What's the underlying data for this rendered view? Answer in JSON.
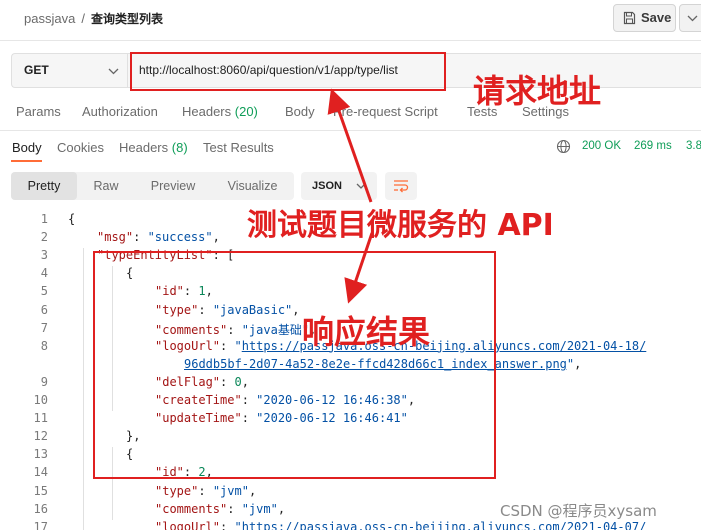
{
  "breadcrumb": {
    "collection": "passjava",
    "separator": "/",
    "request": "查询类型列表"
  },
  "toolbar": {
    "save_label": "Save"
  },
  "request": {
    "method": "GET",
    "url": "http://localhost:8060/api/question/v1/app/type/list"
  },
  "request_tabs": [
    {
      "label": "Params"
    },
    {
      "label": "Authorization"
    },
    {
      "label": "Headers",
      "count": "(20)"
    },
    {
      "label": "Body"
    },
    {
      "label": "Pre-request Script"
    },
    {
      "label": "Tests"
    },
    {
      "label": "Settings"
    }
  ],
  "response_tabs": [
    {
      "label": "Body",
      "active": true
    },
    {
      "label": "Cookies"
    },
    {
      "label": "Headers",
      "count": "(8)"
    },
    {
      "label": "Test Results"
    }
  ],
  "response_status": {
    "code": "200 OK",
    "time": "269 ms",
    "size": "3.8"
  },
  "view_modes": [
    "Pretty",
    "Raw",
    "Preview",
    "Visualize"
  ],
  "format": "JSON",
  "code_lines": [
    {
      "n": "1",
      "indent": 0,
      "tokens": [
        {
          "t": "p",
          "v": "{"
        }
      ]
    },
    {
      "n": "2",
      "indent": 1,
      "tokens": [
        {
          "t": "k",
          "v": "\"msg\""
        },
        {
          "t": "p",
          "v": ": "
        },
        {
          "t": "s",
          "v": "\"success\""
        },
        {
          "t": "p",
          "v": ","
        }
      ]
    },
    {
      "n": "3",
      "indent": 1,
      "tokens": [
        {
          "t": "k",
          "v": "\"typeEntityList\""
        },
        {
          "t": "p",
          "v": ": ["
        }
      ]
    },
    {
      "n": "4",
      "indent": 2,
      "tokens": [
        {
          "t": "p",
          "v": "{"
        }
      ]
    },
    {
      "n": "5",
      "indent": 3,
      "tokens": [
        {
          "t": "k",
          "v": "\"id\""
        },
        {
          "t": "p",
          "v": ": "
        },
        {
          "t": "n",
          "v": "1"
        },
        {
          "t": "p",
          "v": ","
        }
      ]
    },
    {
      "n": "6",
      "indent": 3,
      "tokens": [
        {
          "t": "k",
          "v": "\"type\""
        },
        {
          "t": "p",
          "v": ": "
        },
        {
          "t": "s",
          "v": "\"javaBasic\""
        },
        {
          "t": "p",
          "v": ","
        }
      ]
    },
    {
      "n": "7",
      "indent": 3,
      "tokens": [
        {
          "t": "k",
          "v": "\"comments\""
        },
        {
          "t": "p",
          "v": ": "
        },
        {
          "t": "s",
          "v": "\"java基础\""
        },
        {
          "t": "p",
          "v": ","
        }
      ]
    },
    {
      "n": "8",
      "indent": 3,
      "tokens": [
        {
          "t": "k",
          "v": "\"logoUrl\""
        },
        {
          "t": "p",
          "v": ": "
        },
        {
          "t": "s",
          "v": "\""
        },
        {
          "t": "u",
          "v": "https://passjava.oss-cn-beijing.aliyuncs.com/2021-04-18/"
        }
      ]
    },
    {
      "n": "",
      "indent": 4,
      "tokens": [
        {
          "t": "u",
          "v": "96ddb5bf-2d07-4a52-8e2e-ffcd428d66c1_index_answer.png"
        },
        {
          "t": "s",
          "v": "\""
        },
        {
          "t": "p",
          "v": ","
        }
      ]
    },
    {
      "n": "9",
      "indent": 3,
      "tokens": [
        {
          "t": "k",
          "v": "\"delFlag\""
        },
        {
          "t": "p",
          "v": ": "
        },
        {
          "t": "n",
          "v": "0"
        },
        {
          "t": "p",
          "v": ","
        }
      ]
    },
    {
      "n": "10",
      "indent": 3,
      "tokens": [
        {
          "t": "k",
          "v": "\"createTime\""
        },
        {
          "t": "p",
          "v": ": "
        },
        {
          "t": "s",
          "v": "\"2020-06-12 16:46:38\""
        },
        {
          "t": "p",
          "v": ","
        }
      ]
    },
    {
      "n": "11",
      "indent": 3,
      "tokens": [
        {
          "t": "k",
          "v": "\"updateTime\""
        },
        {
          "t": "p",
          "v": ": "
        },
        {
          "t": "s",
          "v": "\"2020-06-12 16:46:41\""
        }
      ]
    },
    {
      "n": "12",
      "indent": 2,
      "tokens": [
        {
          "t": "p",
          "v": "},"
        }
      ]
    },
    {
      "n": "13",
      "indent": 2,
      "tokens": [
        {
          "t": "p",
          "v": "{"
        }
      ]
    },
    {
      "n": "14",
      "indent": 3,
      "tokens": [
        {
          "t": "k",
          "v": "\"id\""
        },
        {
          "t": "p",
          "v": ": "
        },
        {
          "t": "n",
          "v": "2"
        },
        {
          "t": "p",
          "v": ","
        }
      ]
    },
    {
      "n": "15",
      "indent": 3,
      "tokens": [
        {
          "t": "k",
          "v": "\"type\""
        },
        {
          "t": "p",
          "v": ": "
        },
        {
          "t": "s",
          "v": "\"jvm\""
        },
        {
          "t": "p",
          "v": ","
        }
      ]
    },
    {
      "n": "16",
      "indent": 3,
      "tokens": [
        {
          "t": "k",
          "v": "\"comments\""
        },
        {
          "t": "p",
          "v": ": "
        },
        {
          "t": "s",
          "v": "\"jvm\""
        },
        {
          "t": "p",
          "v": ","
        }
      ]
    },
    {
      "n": "17",
      "indent": 3,
      "tokens": [
        {
          "t": "k",
          "v": "\"logoUrl\""
        },
        {
          "t": "p",
          "v": ": "
        },
        {
          "t": "s",
          "v": "\""
        },
        {
          "t": "u",
          "v": "https://passjava.oss-cn-beijing.aliyuncs.com/2021-04-07/"
        }
      ]
    }
  ],
  "annotations": {
    "url_label": "请求地址",
    "api_label": "测试题目微服务的 API",
    "result_label": "响应结果",
    "color": "#e02020"
  },
  "watermark": "CSDN @程序员xysam",
  "colors": {
    "accent": "#ff6c37",
    "success": "#0f9d58",
    "key": "#a31515",
    "string": "#0451a5",
    "number": "#098658"
  }
}
